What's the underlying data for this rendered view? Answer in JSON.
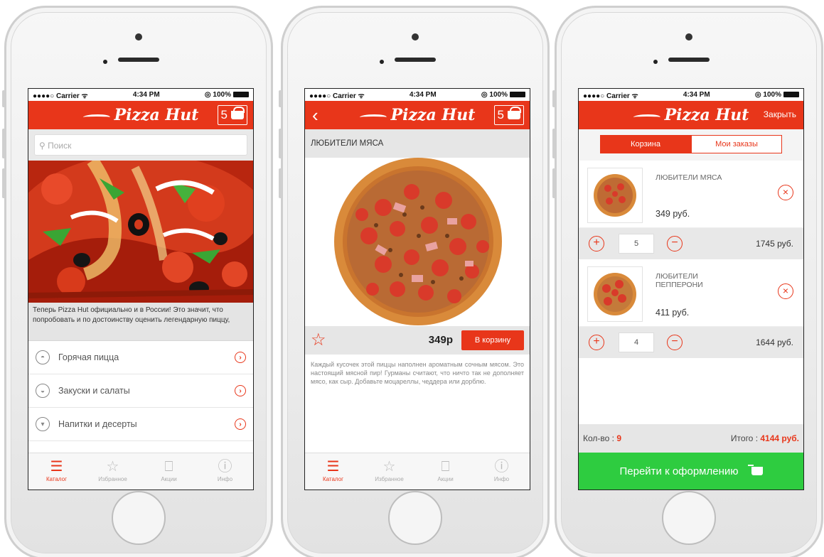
{
  "colors": {
    "brand_red": "#e8361a",
    "checkout_green": "#2ecc40"
  },
  "status_bar": {
    "carrier": "●●●●○ Carrier ᯤ",
    "time": "4:34 PM",
    "battery": "◎ 100%"
  },
  "navbar": {
    "logo_text": "Pizza Hut",
    "cart_count": "5",
    "back_icon": "‹",
    "close_label": "Закрыть"
  },
  "tabbar": [
    {
      "label": "Каталог",
      "icon": "menu-icon",
      "glyph": "☰"
    },
    {
      "label": "Избранное",
      "icon": "star-icon",
      "glyph": "☆"
    },
    {
      "label": "Акции",
      "icon": "bookmark-icon",
      "glyph": "⎕"
    },
    {
      "label": "Инфо",
      "icon": "info-icon",
      "glyph": "ⓘ"
    }
  ],
  "catalog": {
    "search_placeholder": "Поиск",
    "promo_text": "Теперь Pizza Hut официально и в России! Это значит, что попробовать и по достоинству оценить легендарную пиццу,",
    "categories": [
      {
        "label": "Горячая пицца",
        "icon": "pizza-icon"
      },
      {
        "label": "Закуски и салаты",
        "icon": "salad-icon"
      },
      {
        "label": "Напитки и десерты",
        "icon": "drink-icon"
      }
    ]
  },
  "product": {
    "title": "ЛЮБИТЕЛИ МЯСА",
    "price": "349р",
    "add_to_cart": "В корзину",
    "description": "Каждый кусочек этой пиццы наполнен ароматным сочным мясом. Это настоящий мясной пир! Гурманы считают, что ничто так не дополняет мясо, как сыр. Добавьте моцареллы, чеддера или дорблю."
  },
  "cart": {
    "tabs": [
      "Корзина",
      "Мои заказы"
    ],
    "items": [
      {
        "name": "ЛЮБИТЕЛИ МЯСА",
        "unit_price": "349 руб.",
        "qty": "5",
        "line_total": "1745 руб."
      },
      {
        "name": "ЛЮБИТЕЛИ ПЕППЕРОНИ",
        "unit_price": "411 руб.",
        "qty": "4",
        "line_total": "1644 руб."
      }
    ],
    "count_label": "Кол-во :",
    "count_value": "9",
    "total_label": "Итого :",
    "total_value": "4144 руб.",
    "checkout_label": "Перейти к оформлению"
  }
}
